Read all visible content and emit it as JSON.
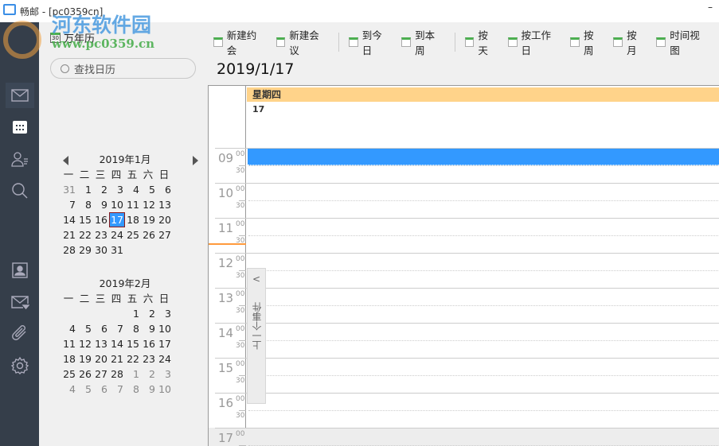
{
  "window": {
    "title": "畅邮 - [pc0359cn]",
    "minimize": "–"
  },
  "watermark": {
    "name": "河东软件园",
    "url": "www.pc0359.cn"
  },
  "sidebar": {
    "items": [
      {
        "name": "mail"
      },
      {
        "name": "calendar"
      },
      {
        "name": "contacts"
      },
      {
        "name": "search"
      },
      {
        "name": "address-book"
      },
      {
        "name": "mail-filter"
      },
      {
        "name": "attachments"
      },
      {
        "name": "settings"
      }
    ]
  },
  "left": {
    "wannianli": "万年历",
    "search_placeholder": "查找日历"
  },
  "weekdays": [
    "一",
    "二",
    "三",
    "四",
    "五",
    "六",
    "日"
  ],
  "jan": {
    "title": "2019年1月",
    "days": [
      [
        "31",
        1
      ],
      [
        "1"
      ],
      [
        "2"
      ],
      [
        "3"
      ],
      [
        "4"
      ],
      [
        "5"
      ],
      [
        "6"
      ],
      [
        "7"
      ],
      [
        "8"
      ],
      [
        "9"
      ],
      [
        "10"
      ],
      [
        "11"
      ],
      [
        "12"
      ],
      [
        "13"
      ],
      [
        "14"
      ],
      [
        "15"
      ],
      [
        "16"
      ],
      [
        "17",
        2
      ],
      [
        "18"
      ],
      [
        "19"
      ],
      [
        "20"
      ],
      [
        "21"
      ],
      [
        "22"
      ],
      [
        "23"
      ],
      [
        "24"
      ],
      [
        "25"
      ],
      [
        "26"
      ],
      [
        "27"
      ],
      [
        "28"
      ],
      [
        "29"
      ],
      [
        "30"
      ],
      [
        "31"
      ]
    ]
  },
  "feb": {
    "title": "2019年2月",
    "days": [
      [
        "",
        0
      ],
      [
        "",
        0
      ],
      [
        "",
        0
      ],
      [
        "",
        0
      ],
      [
        "1"
      ],
      [
        "2"
      ],
      [
        "3"
      ],
      [
        "4"
      ],
      [
        "5"
      ],
      [
        "6"
      ],
      [
        "7"
      ],
      [
        "8"
      ],
      [
        "9"
      ],
      [
        "10"
      ],
      [
        "11"
      ],
      [
        "12"
      ],
      [
        "13"
      ],
      [
        "14"
      ],
      [
        "15"
      ],
      [
        "16"
      ],
      [
        "17"
      ],
      [
        "18"
      ],
      [
        "19"
      ],
      [
        "20"
      ],
      [
        "21"
      ],
      [
        "22"
      ],
      [
        "23"
      ],
      [
        "24"
      ],
      [
        "25"
      ],
      [
        "26"
      ],
      [
        "27"
      ],
      [
        "28"
      ],
      [
        "1",
        1
      ],
      [
        "2",
        1
      ],
      [
        "3",
        1
      ],
      [
        "4",
        1
      ],
      [
        "5",
        1
      ],
      [
        "6",
        1
      ],
      [
        "7",
        1
      ],
      [
        "8",
        1
      ],
      [
        "9",
        1
      ],
      [
        "10",
        1
      ]
    ]
  },
  "toolbar": {
    "groups": [
      [
        "新建约会",
        "新建会议"
      ],
      [
        "到今日",
        "到本周"
      ],
      [
        "按天",
        "按工作日",
        "按周",
        "按月",
        "时间视图"
      ]
    ]
  },
  "main": {
    "date": "2019/1/17",
    "day_header": "星期四",
    "day_number": "17",
    "hours": [
      "09",
      "10",
      "11",
      "12",
      "13",
      "14",
      "15",
      "16",
      "17"
    ],
    "min00": "00",
    "min30": "30",
    "prev_event": "上一个事件",
    "prev_chevron": "<"
  }
}
